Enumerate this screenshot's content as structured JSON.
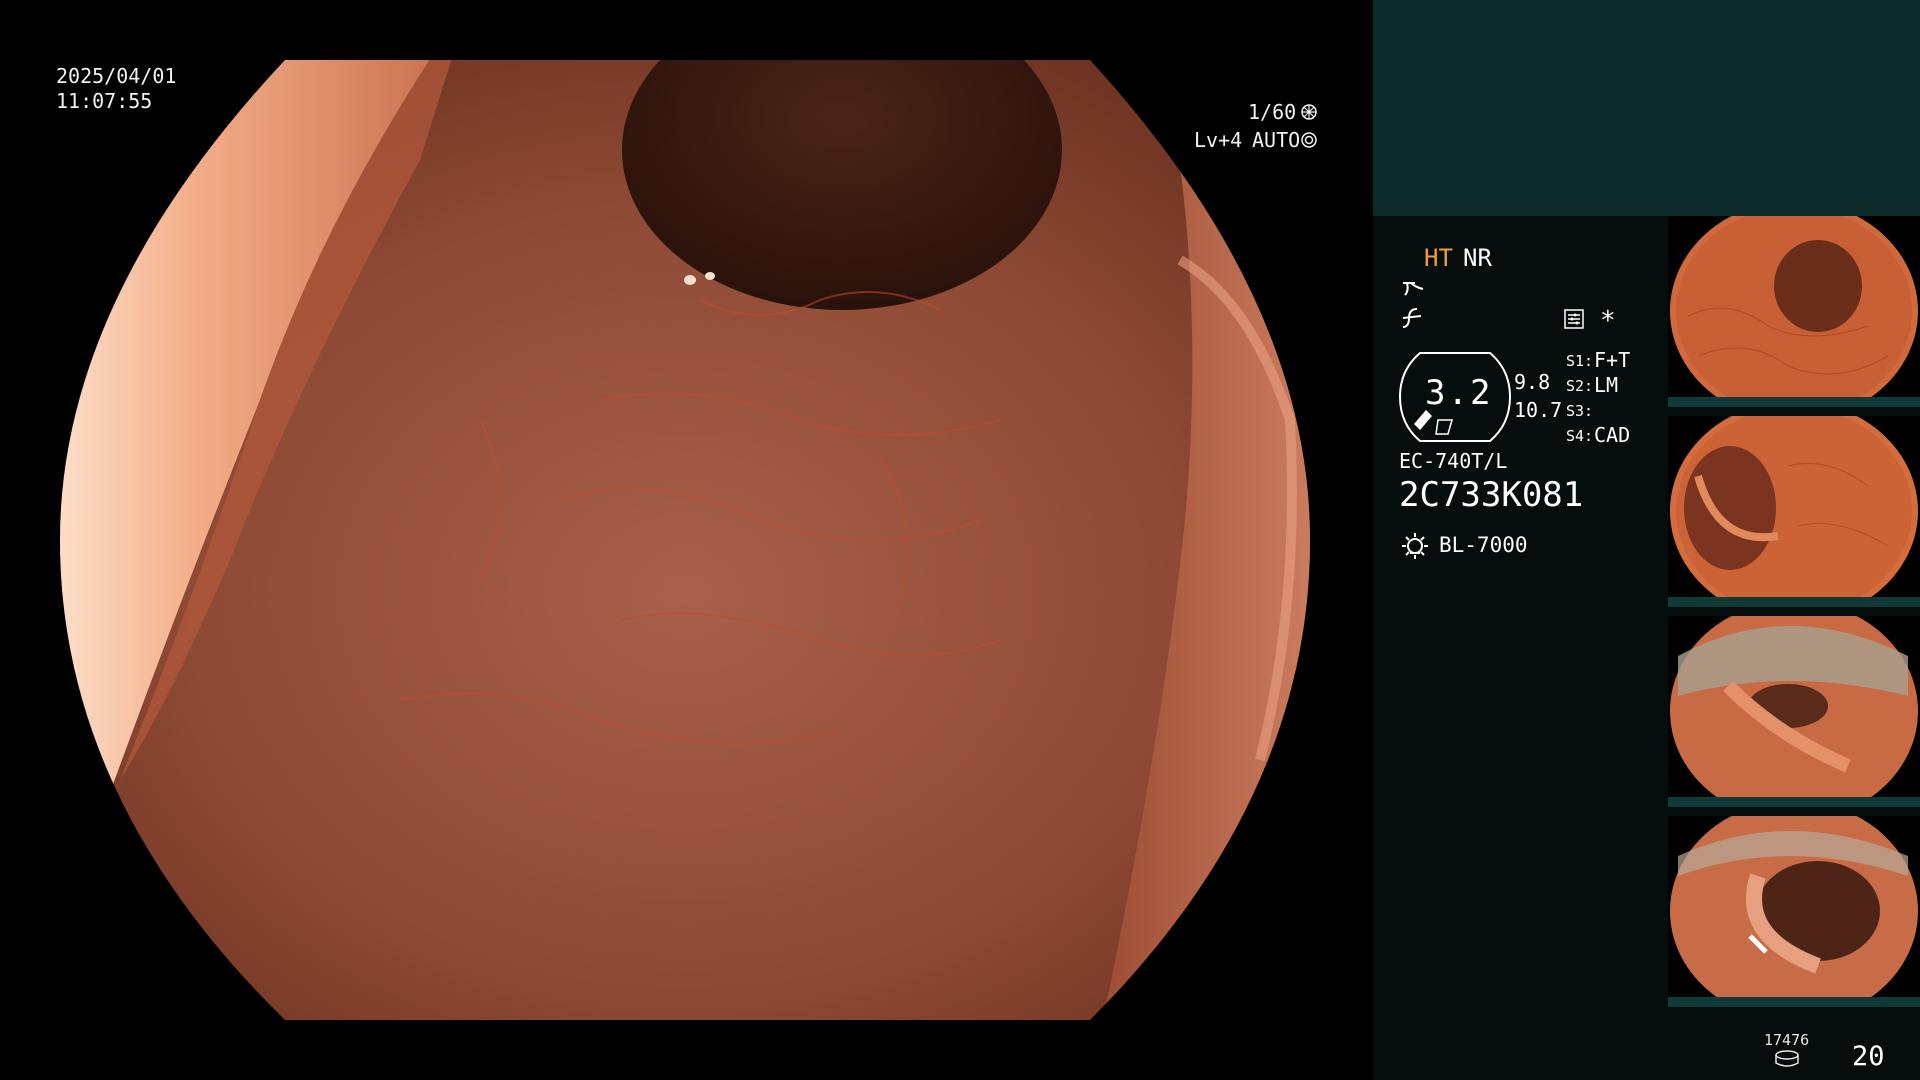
{
  "overlay": {
    "date": "2025/04/01",
    "time": "11:07:55",
    "shutter": "1/60",
    "level": "Lv+4",
    "iris_mode": "AUTO"
  },
  "panel": {
    "mode_ht": "HT",
    "mode_nr": "NR",
    "zoom_value": "3.2",
    "zoom_upper": "9.8",
    "zoom_lower": "10.7",
    "s1_label": "S1:",
    "s1_value": "F+T",
    "s2_label": "S2:",
    "s2_value": "LM",
    "s3_label": "S3:",
    "s3_value": "",
    "s4_label": "S4:",
    "s4_value": "CAD",
    "asterisk": "*",
    "scope_model": "EC-740T/L",
    "scope_serial": "2C733K081",
    "light_source": "BL-7000",
    "storage_count": "17476",
    "image_count": "20"
  },
  "colors": {
    "accent_orange": "#f0a030",
    "panel_bg": "#060d0d",
    "panel_top_bg": "#0d2a2b",
    "thumb_bar": "#0f3a38"
  },
  "icons": [
    "shutter-icon",
    "iris-icon",
    "enhance-icon",
    "contrast-icon",
    "settings-icon",
    "light-source-icon",
    "storage-icon"
  ]
}
